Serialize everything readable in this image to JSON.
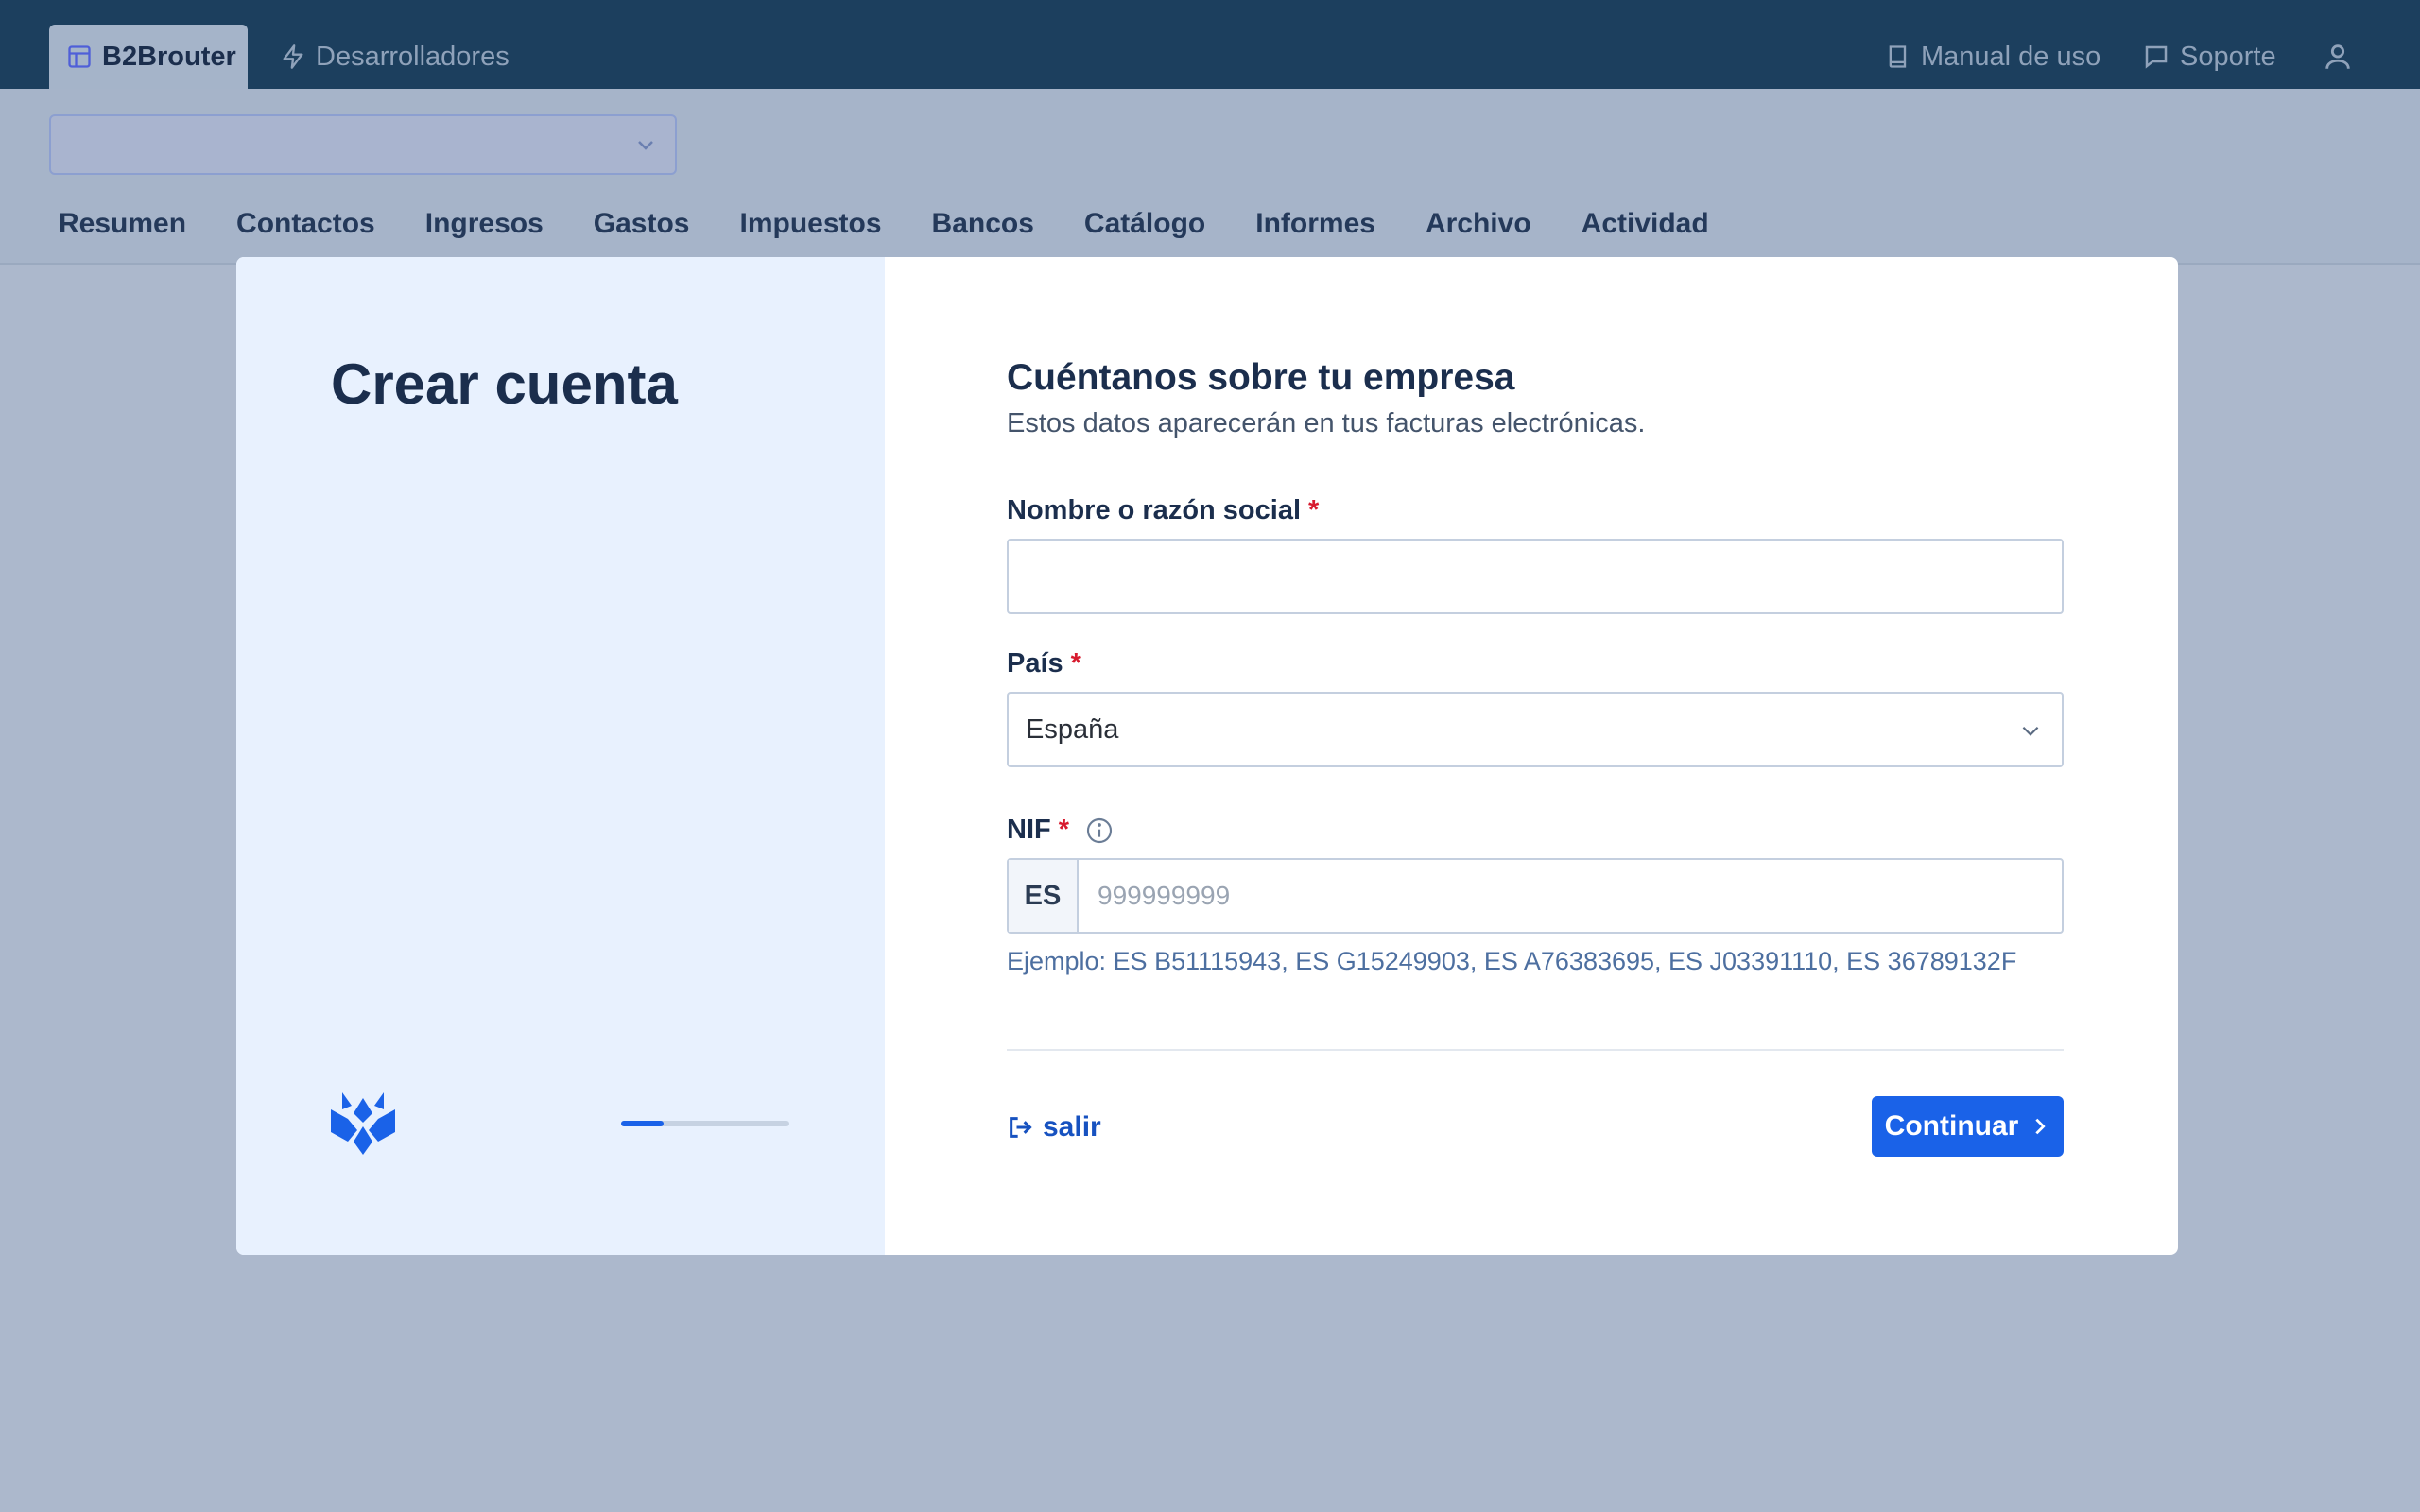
{
  "topbar": {
    "tabs": [
      {
        "label": "B2Brouter",
        "icon": "layout-icon",
        "active": true
      },
      {
        "label": "Desarrolladores",
        "icon": "bolt-icon",
        "active": false
      }
    ],
    "right": {
      "manual_label": "Manual de uso",
      "support_label": "Soporte"
    }
  },
  "company_selector": {
    "value": ""
  },
  "main_nav": [
    "Resumen",
    "Contactos",
    "Ingresos",
    "Gastos",
    "Impuestos",
    "Bancos",
    "Catálogo",
    "Informes",
    "Archivo",
    "Actividad"
  ],
  "modal": {
    "title": "Crear cuenta",
    "progress": 0.25,
    "form": {
      "heading": "Cuéntanos sobre tu empresa",
      "subheading": "Estos datos aparecerán en tus facturas electrónicas.",
      "name_label": "Nombre o razón social",
      "name_value": "",
      "country_label": "País",
      "country_value": "España",
      "nif_label": "NIF",
      "nif_prefix": "ES",
      "nif_placeholder": "999999999",
      "nif_hint": "Ejemplo: ES B51115943, ES G15249903, ES A76383695, ES J03391110, ES 36789132F",
      "required_mark": "*"
    },
    "exit_label": "salir",
    "continue_label": "Continuar"
  },
  "colors": {
    "topbar": "#1c3f5e",
    "accent": "#1a62e8",
    "required": "#d71a2e",
    "overlay": "#acb8cc"
  }
}
